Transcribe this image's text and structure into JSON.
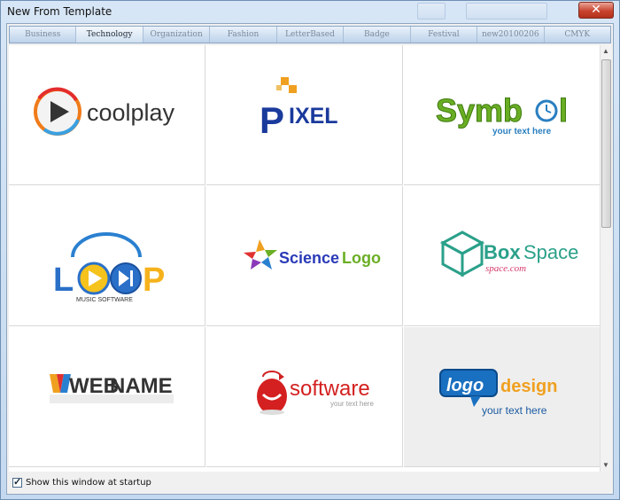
{
  "window": {
    "title": "New From Template",
    "close_glyph": "✕"
  },
  "tabs": [
    {
      "label": "Business",
      "active": false
    },
    {
      "label": "Technology",
      "active": true
    },
    {
      "label": "Organization",
      "active": false
    },
    {
      "label": "Fashion",
      "active": false
    },
    {
      "label": "LetterBased",
      "active": false
    },
    {
      "label": "Badge",
      "active": false
    },
    {
      "label": "Festival",
      "active": false
    },
    {
      "label": "new20100206",
      "active": false
    },
    {
      "label": "CMYK",
      "active": false
    }
  ],
  "templates": [
    {
      "name": "coolplay"
    },
    {
      "name_first": "P",
      "name_rest": "IXEL"
    },
    {
      "name_a": "Symb",
      "name_b": "l",
      "tagline": "your text here"
    },
    {
      "name_a": "L",
      "name_b": "P",
      "caption": "MUSIC SOFTWARE"
    },
    {
      "name_a": "Science",
      "name_b": "Logo"
    },
    {
      "name_a": "Box",
      "name_b": "Space",
      "sub": "space.com"
    },
    {
      "name_a": "WEB",
      "name_b": "NAME"
    },
    {
      "name": "software",
      "tagline": "your text here"
    },
    {
      "badge": "logo",
      "name": "design",
      "tagline": "your text here"
    }
  ],
  "colors": {
    "selected_bg": "#eeeeee",
    "tab_active": "#1d2a38"
  },
  "footer": {
    "checkbox_label": "Show this window at startup",
    "checked": true,
    "check_glyph": "✓"
  }
}
